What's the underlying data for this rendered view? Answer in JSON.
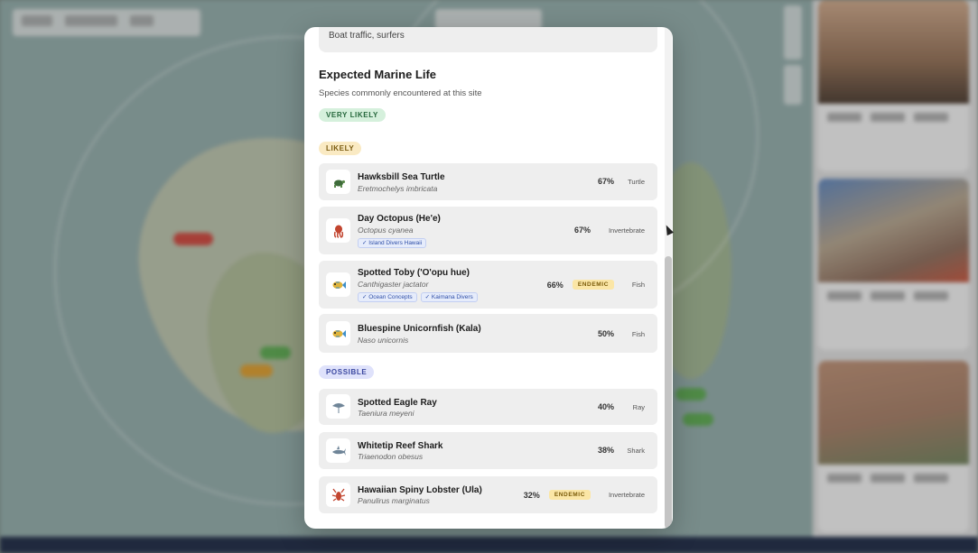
{
  "modal": {
    "hazard_text": "Boat traffic, surfers",
    "section_title": "Expected Marine Life",
    "section_subtitle": "Species commonly encountered at this site",
    "groups": {
      "very_likely": "VERY LIKELY",
      "likely": "LIKELY",
      "possible": "POSSIBLE"
    },
    "species": [
      {
        "name": "Hawksbill Sea Turtle",
        "scientific": "Eretmochelys imbricata",
        "percent": "67%",
        "category": "Turtle",
        "icon": "turtle-icon",
        "tags": [],
        "endemic": ""
      },
      {
        "name": "Day Octopus (He'e)",
        "scientific": "Octopus cyanea",
        "percent": "67%",
        "category": "Invertebrate",
        "icon": "octopus-icon",
        "tags": [
          "✓ Island Divers Hawaii"
        ],
        "endemic": ""
      },
      {
        "name": "Spotted Toby ('O'opu hue)",
        "scientific": "Canthigaster jactator",
        "percent": "66%",
        "category": "Fish",
        "icon": "fish-icon",
        "tags": [
          "✓ Ocean Concepts",
          "✓ Kaimana Divers"
        ],
        "endemic": "ENDEMIC"
      },
      {
        "name": "Bluespine Unicornfish (Kala)",
        "scientific": "Naso unicornis",
        "percent": "50%",
        "category": "Fish",
        "icon": "fish-icon",
        "tags": [],
        "endemic": ""
      },
      {
        "name": "Spotted Eagle Ray",
        "scientific": "Taeniura meyeni",
        "percent": "40%",
        "category": "Ray",
        "icon": "ray-icon",
        "tags": [],
        "endemic": ""
      },
      {
        "name": "Whitetip Reef Shark",
        "scientific": "Triaenodon obesus",
        "percent": "38%",
        "category": "Shark",
        "icon": "shark-icon",
        "tags": [],
        "endemic": ""
      },
      {
        "name": "Hawaiian Spiny Lobster (Ula)",
        "scientific": "Panulirus marginatus",
        "percent": "32%",
        "category": "Invertebrate",
        "icon": "lobster-icon",
        "tags": [],
        "endemic": "ENDEMIC"
      }
    ]
  },
  "colors": {
    "very_likely_badge": "#d5f0dc",
    "likely_badge": "#faeac3",
    "possible_badge": "#dfe2fb",
    "endemic_badge": "#fbe6a6",
    "tag_blue": "#2f4fa8"
  }
}
